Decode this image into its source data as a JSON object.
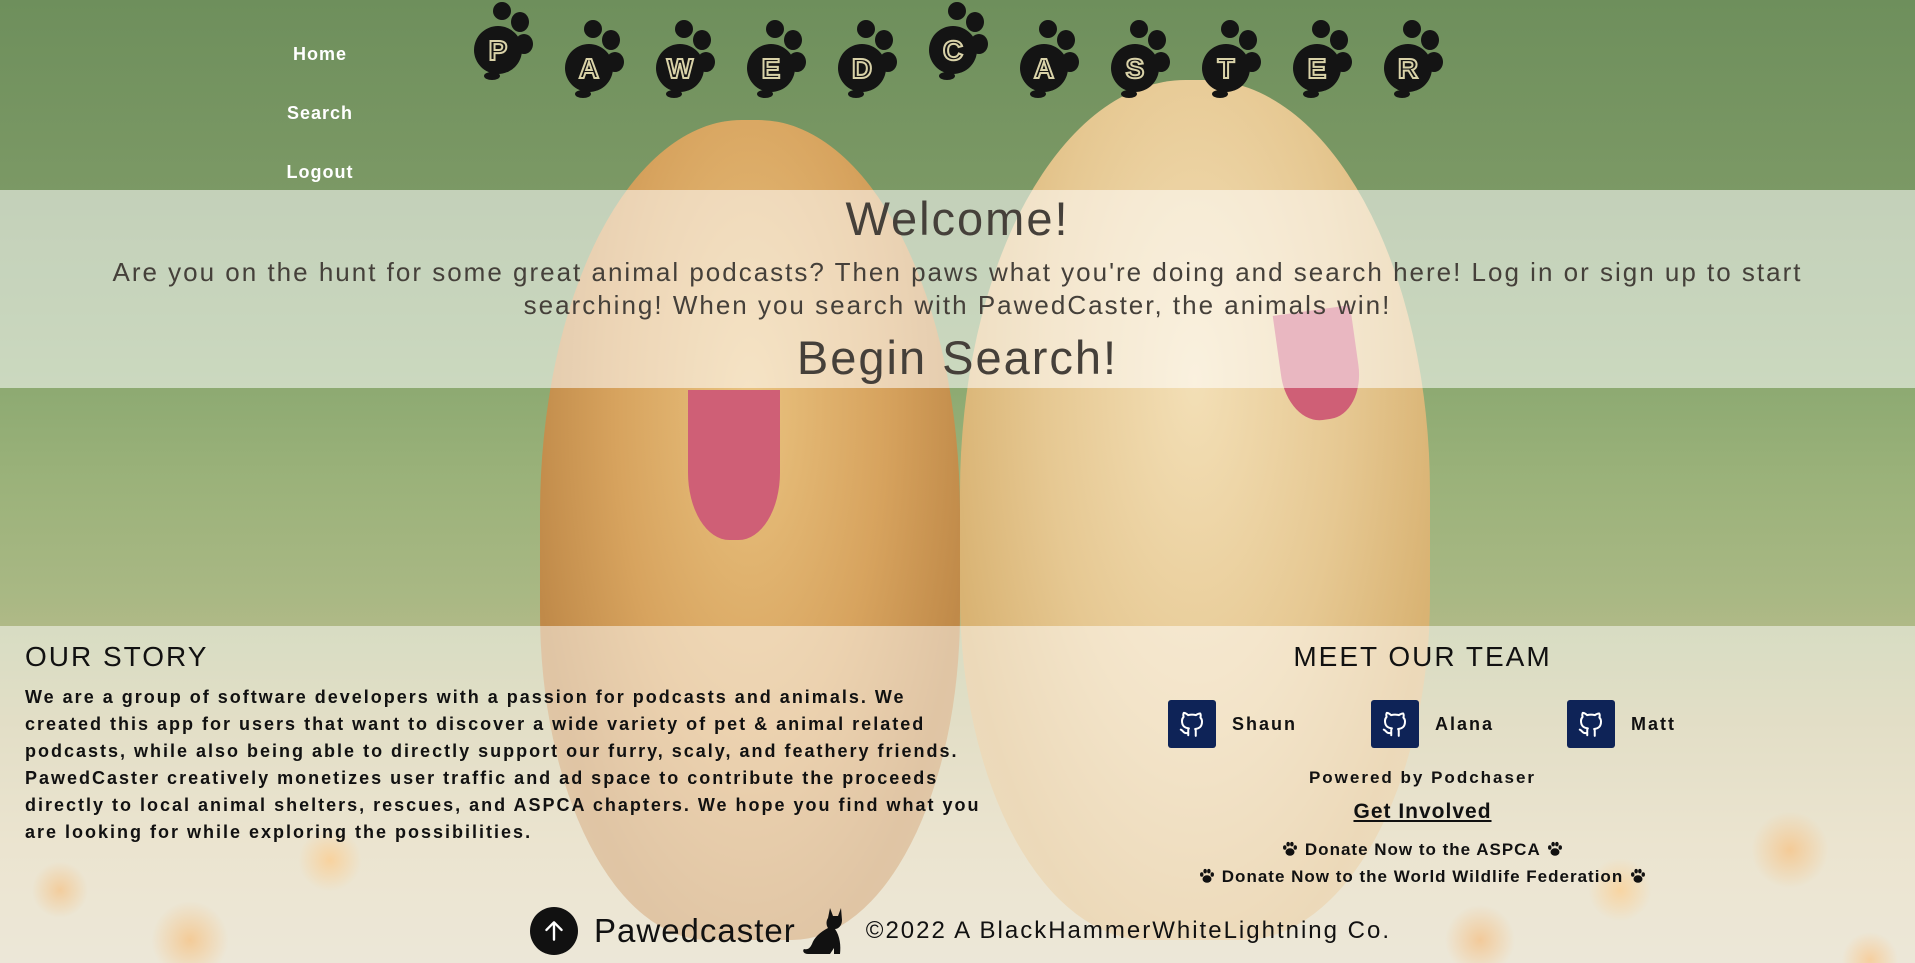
{
  "nav": {
    "items": [
      "Home",
      "Search",
      "Logout"
    ]
  },
  "logo": {
    "letters": [
      "P",
      "A",
      "W",
      "E",
      "D",
      "C",
      "A",
      "S",
      "T",
      "E",
      "R"
    ]
  },
  "welcome": {
    "title": "Welcome!",
    "text": "Are you on the hunt for some great animal podcasts? Then paws what you're doing and search here! Log in or sign up to start searching! When you search with PawedCaster, the animals win!",
    "cta": "Begin Search!"
  },
  "story": {
    "title": "OUR STORY",
    "text": "We are a group of software developers with a passion for podcasts and animals. We created this app for users that want to discover a wide variety of pet & animal related podcasts, while also being able to directly support our furry, scaly, and feathery friends. PawedCaster creatively monetizes user traffic and ad space to contribute the proceeds directly to local animal shelters, rescues, and ASPCA chapters. We hope you find what you are looking for while exploring the possibilities."
  },
  "team": {
    "title": "MEET OUR TEAM",
    "members": [
      "Shaun",
      "Alana",
      "Matt"
    ],
    "icon": "github-icon"
  },
  "powered_by": "Powered by Podchaser",
  "involved": {
    "title": "Get Involved",
    "links": [
      "Donate Now to the ASPCA",
      "Donate Now to the World Wildlife Federation"
    ]
  },
  "footer": {
    "brand": "Pawedcaster",
    "copyright": "©2022 A BlackHammerWhiteLightning Co."
  },
  "colors": {
    "github_tile": "#0e2357",
    "overlay": "rgba(255,255,255,0.55)"
  }
}
